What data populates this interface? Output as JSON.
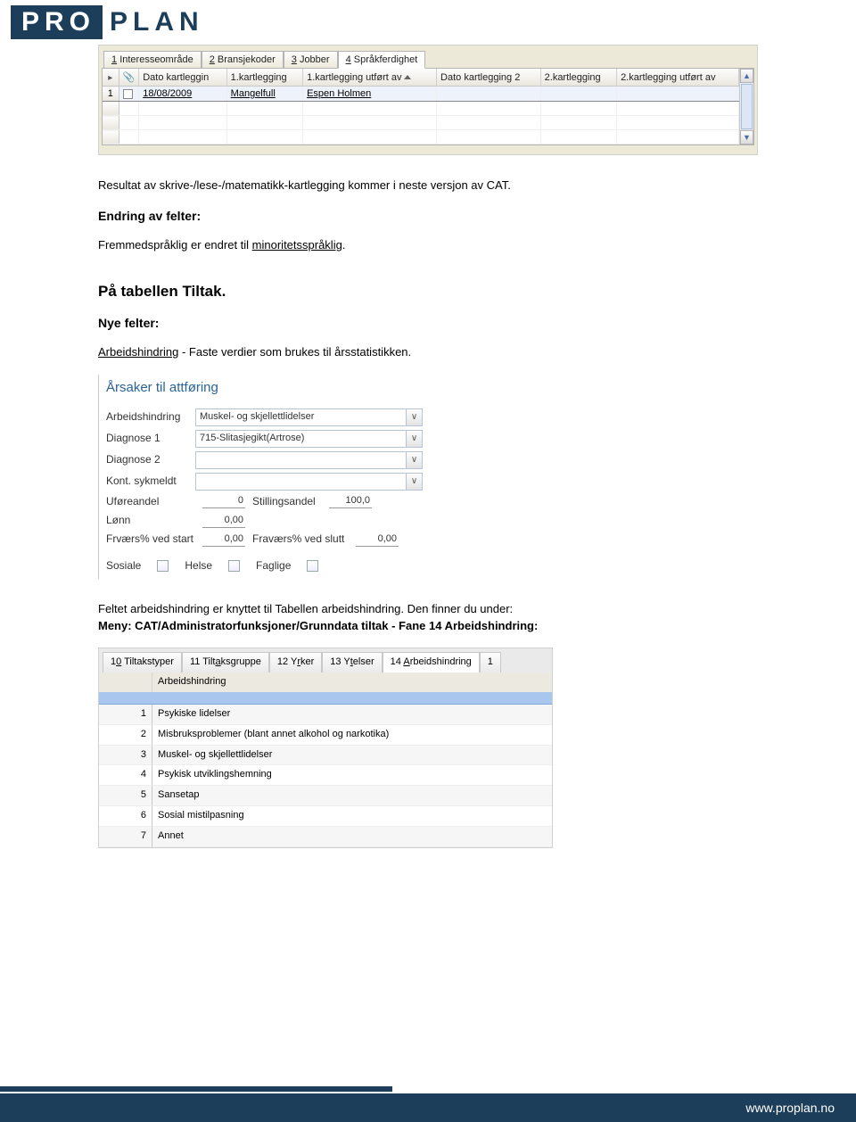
{
  "logo": {
    "left": "PRO",
    "right": "PLAN"
  },
  "footer": {
    "url": "www.proplan.no"
  },
  "win1": {
    "tabs": [
      {
        "num": "1",
        "label": "Interesseområde"
      },
      {
        "num": "2",
        "label": "Bransjekoder"
      },
      {
        "num": "3",
        "label": "Jobber"
      },
      {
        "num": "4",
        "label": "Språkferdighet"
      }
    ],
    "cols": [
      "Dato kartleggin",
      "1.kartlegging",
      "1.kartlegging utført av",
      "Dato kartlegging 2",
      "2.kartlegging",
      "2.kartlegging utført av"
    ],
    "rownum": "1",
    "rows": [
      {
        "dato1": "18/08/2009",
        "k1": "Mangelfull",
        "u1": "Espen Holmen",
        "dato2": "",
        "k2": "",
        "u2": ""
      }
    ]
  },
  "body": {
    "p1": "Resultat av skrive-/lese-/matematikk-kartlegging kommer i neste versjon av CAT.",
    "h1": "Endring av felter:",
    "p2a": "Fremmedspråklig er endret til ",
    "p2b": "minoritetsspråklig",
    "p2c": ".",
    "h2": "På tabellen Tiltak.",
    "h3": "Nye felter:",
    "p3a": "Arbeidshindring",
    "p3b": " -  Faste verdier som brukes til årsstatistikken.",
    "p4a": "Feltet arbeidshindring er knyttet til Tabellen arbeidshindring. Den finner du under:",
    "p4b": "Meny: CAT/Administratorfunksjoner/Grunndata tiltak - Fane 14 Arbeidshindring:"
  },
  "win2": {
    "title": "Årsaker til attføring",
    "fields": {
      "arbeidshindring_label": "Arbeidshindring",
      "arbeidshindring_value": "Muskel- og skjellettlidelser",
      "diagnose1_label": "Diagnose 1",
      "diagnose1_value": "715-Slitasjegikt(Artrose)",
      "diagnose2_label": "Diagnose 2",
      "diagnose2_value": "",
      "kontsyk_label": "Kont. sykmeldt",
      "kontsyk_value": "",
      "uforeandel_label": "Uføreandel",
      "uforeandel_value": "0",
      "stillingsandel_label": "Stillingsandel",
      "stillingsandel_value": "100,0",
      "lonn_label": "Lønn",
      "lonn_value": "0,00",
      "frvstart_label": "Frværs% ved start",
      "frvstart_value": "0,00",
      "frvslutt_label": "Fraværs% ved slutt",
      "frvslutt_value": "0,00",
      "sosiale": "Sosiale",
      "helse": "Helse",
      "faglige": "Faglige"
    }
  },
  "win3": {
    "tabs": [
      {
        "num": "10",
        "label": "Tiltakstyper",
        "ul": "0"
      },
      {
        "num": "11",
        "label": "Tiltaksgruppe",
        "ul": "a"
      },
      {
        "num": "12",
        "label": "Yrker",
        "ul": "r"
      },
      {
        "num": "13",
        "label": "Ytelser",
        "ul": "t"
      },
      {
        "num": "14",
        "label": "Arbeidshindring",
        "ul": "A"
      },
      {
        "num": "1",
        "label": "",
        "ul": ""
      }
    ],
    "header": {
      "col2": "Arbeidshindring"
    },
    "rows": [
      {
        "n": "1",
        "t": "Psykiske lidelser"
      },
      {
        "n": "2",
        "t": "Misbruksproblemer (blant annet alkohol og narkotika)"
      },
      {
        "n": "3",
        "t": "Muskel- og skjellettlidelser"
      },
      {
        "n": "4",
        "t": "Psykisk utviklingshemning"
      },
      {
        "n": "5",
        "t": "Sansetap"
      },
      {
        "n": "6",
        "t": "Sosial mistilpasning"
      },
      {
        "n": "7",
        "t": "Annet"
      }
    ]
  }
}
